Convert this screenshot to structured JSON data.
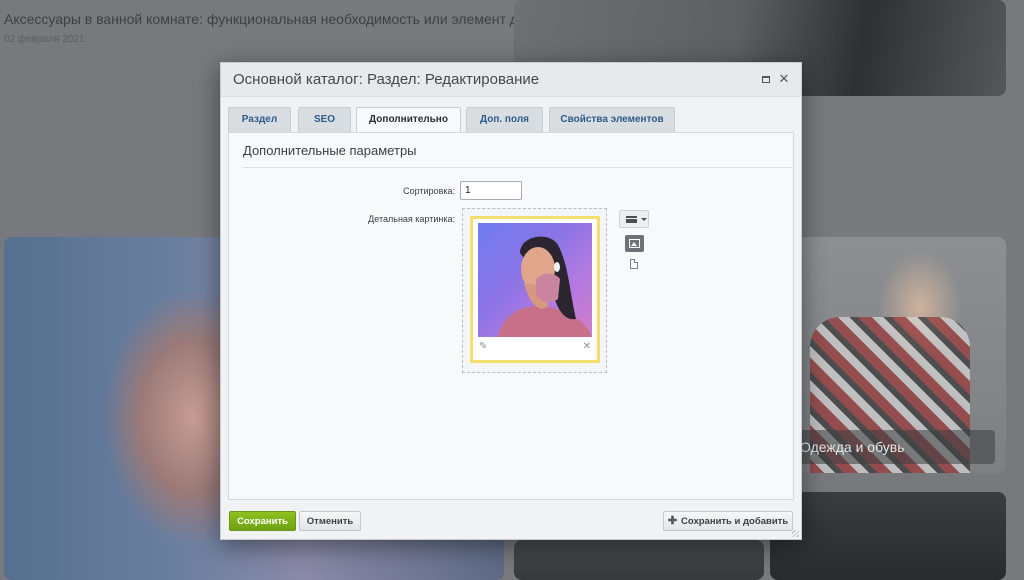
{
  "background": {
    "article_title": "Аксессуары в ванной комнате: функциональная необходимость или элемент д...",
    "article_date": "02 февраля 2021",
    "category_label": "Одежда и обувь"
  },
  "dialog": {
    "title": "Основной каталог: Раздел: Редактирование",
    "tabs": [
      {
        "label": "Раздел"
      },
      {
        "label": "SEO"
      },
      {
        "label": "Дополнительно",
        "active": true
      },
      {
        "label": "Доп. поля"
      },
      {
        "label": "Свойства элементов"
      }
    ],
    "section_title": "Дополнительные параметры",
    "fields": {
      "sort_label": "Сортировка:",
      "sort_value": "1",
      "picture_label": "Детальная картинка:"
    },
    "buttons": {
      "save": "Сохранить",
      "cancel": "Отменить",
      "save_add": "Сохранить и добавить"
    }
  },
  "colors": {
    "accent_green": "#7bb31a",
    "tab_link": "#2f5c8a",
    "image_frame": "#f3df6e"
  },
  "icons": [
    "maximize-icon",
    "close-icon",
    "edit-pencil-icon",
    "remove-x-icon",
    "menu-lines-icon",
    "image-icon",
    "file-icon",
    "plus-icon"
  ]
}
